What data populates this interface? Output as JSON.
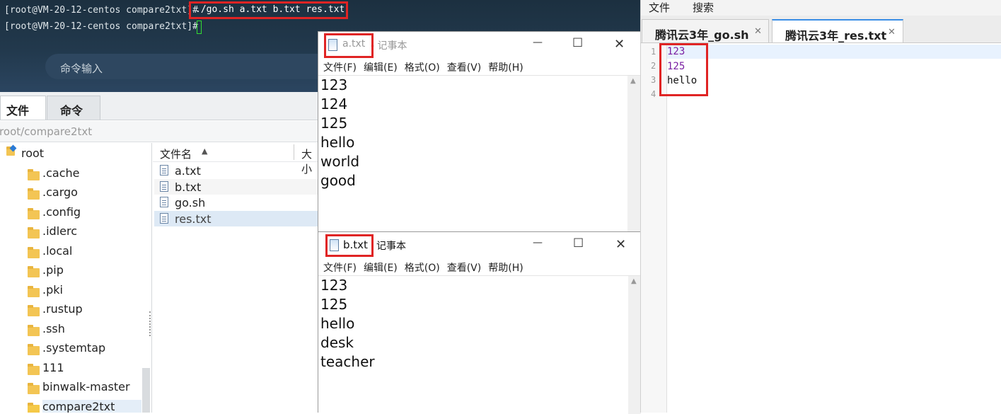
{
  "terminal": {
    "line1_prompt": "[root@VM-20-12-centos compare2txt]#",
    "line1_command": "./go.sh a.txt b.txt res.txt",
    "line2_prompt": "[root@VM-20-12-centos compare2txt]#",
    "command_input_placeholder": "命令输入"
  },
  "file_manager": {
    "tabs": [
      {
        "label": "文件"
      },
      {
        "label": "命令"
      }
    ],
    "path": "/root/compare2txt",
    "tree": [
      {
        "label": "root"
      },
      {
        "label": ".cache"
      },
      {
        "label": ".cargo"
      },
      {
        "label": ".config"
      },
      {
        "label": ".idlerc"
      },
      {
        "label": ".local"
      },
      {
        "label": ".pip"
      },
      {
        "label": ".pki"
      },
      {
        "label": ".rustup"
      },
      {
        "label": ".ssh"
      },
      {
        "label": ".systemtap"
      },
      {
        "label": "111"
      },
      {
        "label": "binwalk-master"
      },
      {
        "label": "compare2txt"
      }
    ],
    "columns": {
      "name": "文件名",
      "size": "大小"
    },
    "files": [
      {
        "name": "a.txt"
      },
      {
        "name": "b.txt"
      },
      {
        "name": "go.sh"
      },
      {
        "name": "res.txt"
      }
    ]
  },
  "notepad_a": {
    "filename": "a.txt",
    "app": "- 记事本",
    "menu": [
      "文件(F)",
      "编辑(E)",
      "格式(O)",
      "查看(V)",
      "帮助(H)"
    ],
    "lines": [
      "123",
      "124",
      "125",
      "hello",
      "world",
      "good"
    ],
    "minimize": "—",
    "maximize": "☐",
    "close": "✕"
  },
  "notepad_b": {
    "filename": "b.txt",
    "app": "记事本",
    "menu": [
      "文件(F)",
      "编辑(E)",
      "格式(O)",
      "查看(V)",
      "帮助(H)"
    ],
    "lines": [
      "123",
      "125",
      "hello",
      "desk",
      "teacher"
    ],
    "minimize": "—",
    "maximize": "☐",
    "close": "✕"
  },
  "editor": {
    "menu": [
      "文件",
      "搜索"
    ],
    "tabs": [
      {
        "label": "腾讯云3年_go.sh",
        "close": "✕"
      },
      {
        "label": "腾讯云3年_res.txt",
        "close": "✕"
      }
    ],
    "line_numbers": [
      "1",
      "2",
      "3",
      "4"
    ],
    "lines": [
      "123",
      "125",
      "hello"
    ],
    "colors": {
      "number": "#7a1fa2",
      "text": "#111111"
    }
  }
}
